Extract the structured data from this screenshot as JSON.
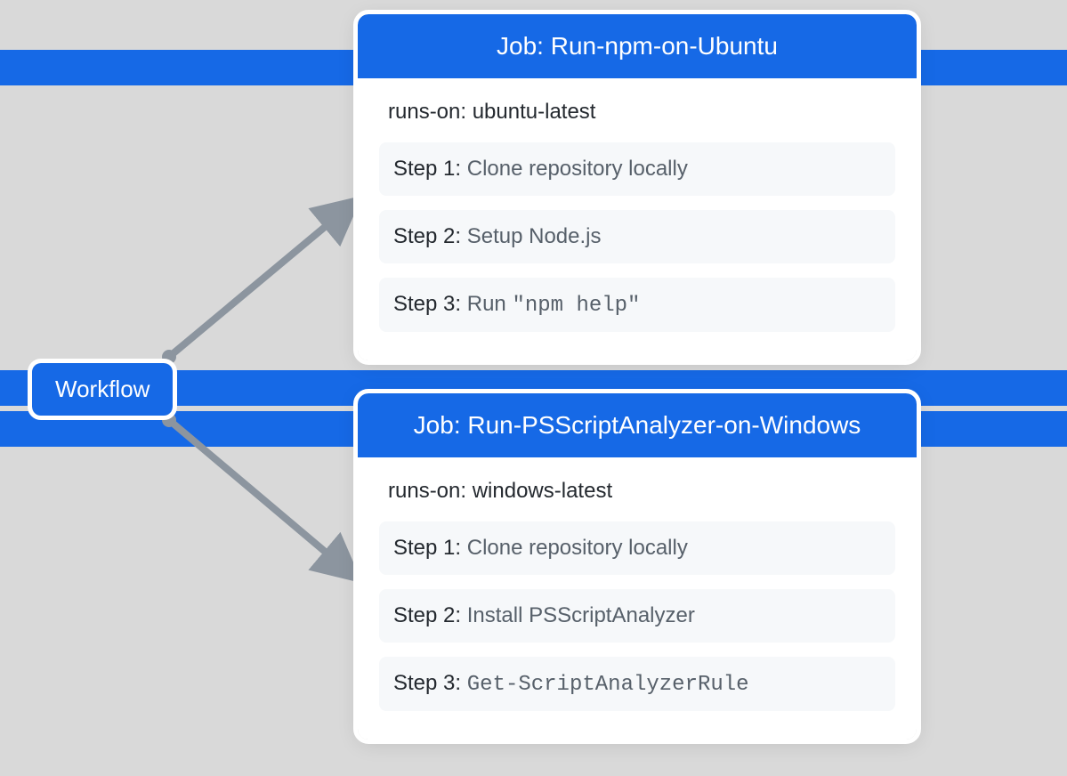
{
  "workflow": {
    "label": "Workflow"
  },
  "jobs": [
    {
      "title": "Job: Run-npm-on-Ubuntu",
      "runs_on": "runs-on: ubuntu-latest",
      "steps": [
        {
          "label": "Step 1:",
          "desc": "Clone repository locally",
          "is_code": false
        },
        {
          "label": "Step 2:",
          "desc": "Setup Node.js",
          "is_code": false
        },
        {
          "label": "Step 3:",
          "prefix": "Run ",
          "code": "\"npm help\"",
          "is_code": true
        }
      ]
    },
    {
      "title": "Job: Run-PSScriptAnalyzer-on-Windows",
      "runs_on": "runs-on: windows-latest",
      "steps": [
        {
          "label": "Step 1:",
          "desc": "Clone repository locally",
          "is_code": false
        },
        {
          "label": "Step 2:",
          "desc": "Install PSScriptAnalyzer",
          "is_code": false
        },
        {
          "label": "Step 3:",
          "code": "Get-ScriptAnalyzerRule",
          "is_code": true
        }
      ]
    }
  ]
}
